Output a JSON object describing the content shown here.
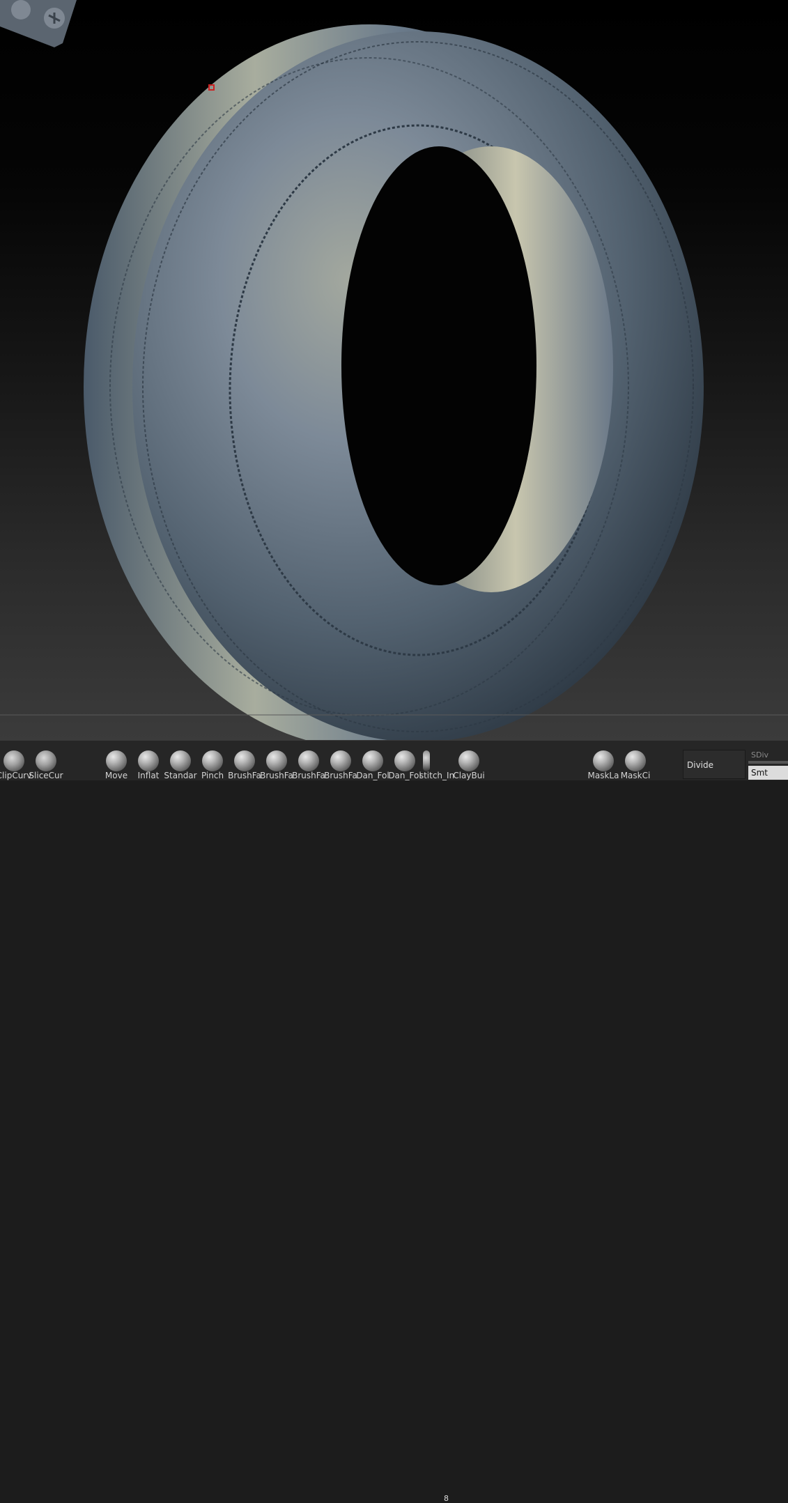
{
  "shelf": {
    "brushes": [
      {
        "label": "ClipCurv",
        "icon": "clip-curve-icon"
      },
      {
        "label": "SliceCur",
        "icon": "slice-curve-icon"
      },
      {
        "label": "Move",
        "icon": "move-brush-icon"
      },
      {
        "label": "Inflat",
        "icon": "inflate-brush-icon"
      },
      {
        "label": "Standar",
        "icon": "standard-brush-icon"
      },
      {
        "label": "Pinch",
        "icon": "pinch-brush-icon"
      },
      {
        "label": "BrushFa",
        "icon": "brush-fa-icon"
      },
      {
        "label": "BrushFa",
        "icon": "brush-fa-icon"
      },
      {
        "label": "BrushFa",
        "icon": "brush-fa-icon"
      },
      {
        "label": "BrushFa",
        "icon": "brush-fa-icon"
      },
      {
        "label": "Dan_Fol",
        "icon": "dan-fol-brush-icon"
      },
      {
        "label": "Dan_Fol",
        "icon": "dan-fol-brush-icon"
      },
      {
        "label": "stitch_In",
        "icon": "stitch-brush-icon"
      },
      {
        "label": "ClayBui",
        "icon": "claybuildup-brush-icon"
      },
      {
        "label": "MaskLa",
        "icon": "mask-lasso-icon"
      },
      {
        "label": "MaskCi",
        "icon": "mask-circle-icon"
      }
    ],
    "stitch_count": "8",
    "divide_label": "Divide",
    "sdiv_label": "SDiv",
    "smt_label": "Smt"
  },
  "colors": {
    "mesh_base": "#5a6a7c",
    "mesh_highlight": "#d8d2b8",
    "mesh_shadow": "#1e2a38",
    "shelf_bg": "#262626"
  }
}
